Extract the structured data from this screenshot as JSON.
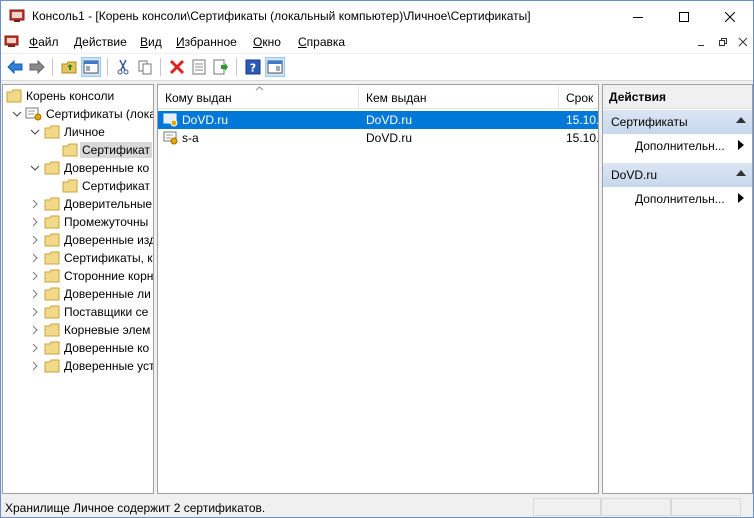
{
  "window": {
    "title": "Консоль1 - [Корень консоли\\Сертификаты (локальный компьютер)\\Личное\\Сертификаты]"
  },
  "menu": {
    "items": [
      {
        "label": "Файл",
        "mnemonic": "Ф"
      },
      {
        "label": "Действие",
        "mnemonic": "Д"
      },
      {
        "label": "Вид",
        "mnemonic": "В"
      },
      {
        "label": "Избранное",
        "mnemonic": "И"
      },
      {
        "label": "Окно",
        "mnemonic": "О"
      },
      {
        "label": "Справка",
        "mnemonic": "С"
      }
    ]
  },
  "tree": {
    "items": [
      {
        "label": "Корень консоли"
      },
      {
        "label": "Сертификаты (лока"
      },
      {
        "label": "Личное"
      },
      {
        "label": "Сертификат"
      },
      {
        "label": "Доверенные ко"
      },
      {
        "label": "Сертификат"
      },
      {
        "label": "Доверительные"
      },
      {
        "label": "Промежуточны"
      },
      {
        "label": "Доверенные изд"
      },
      {
        "label": "Сертификаты, к"
      },
      {
        "label": "Сторонние корн"
      },
      {
        "label": "Доверенные ли"
      },
      {
        "label": "Поставщики се"
      },
      {
        "label": "Корневые элем"
      },
      {
        "label": "Доверенные ко"
      },
      {
        "label": "Доверенные уст"
      }
    ]
  },
  "list": {
    "columns": [
      "Кому выдан",
      "Кем выдан",
      "Срок"
    ],
    "rows": [
      {
        "issued_to": "DoVD.ru",
        "issued_by": "DoVD.ru",
        "expires": "15.10."
      },
      {
        "issued_to": "s-a",
        "issued_by": "DoVD.ru",
        "expires": "15.10."
      }
    ]
  },
  "actions": {
    "header": "Действия",
    "sections": [
      {
        "title": "Сертификаты",
        "item": "Дополнительн..."
      },
      {
        "title": "DoVD.ru",
        "item": "Дополнительн..."
      }
    ]
  },
  "status": {
    "text": "Хранилище Личное содержит 2 сертификатов."
  },
  "colors": {
    "selection": "#0078d7",
    "section_bg": "#c7d7ec",
    "folder": "#e8c25a"
  }
}
